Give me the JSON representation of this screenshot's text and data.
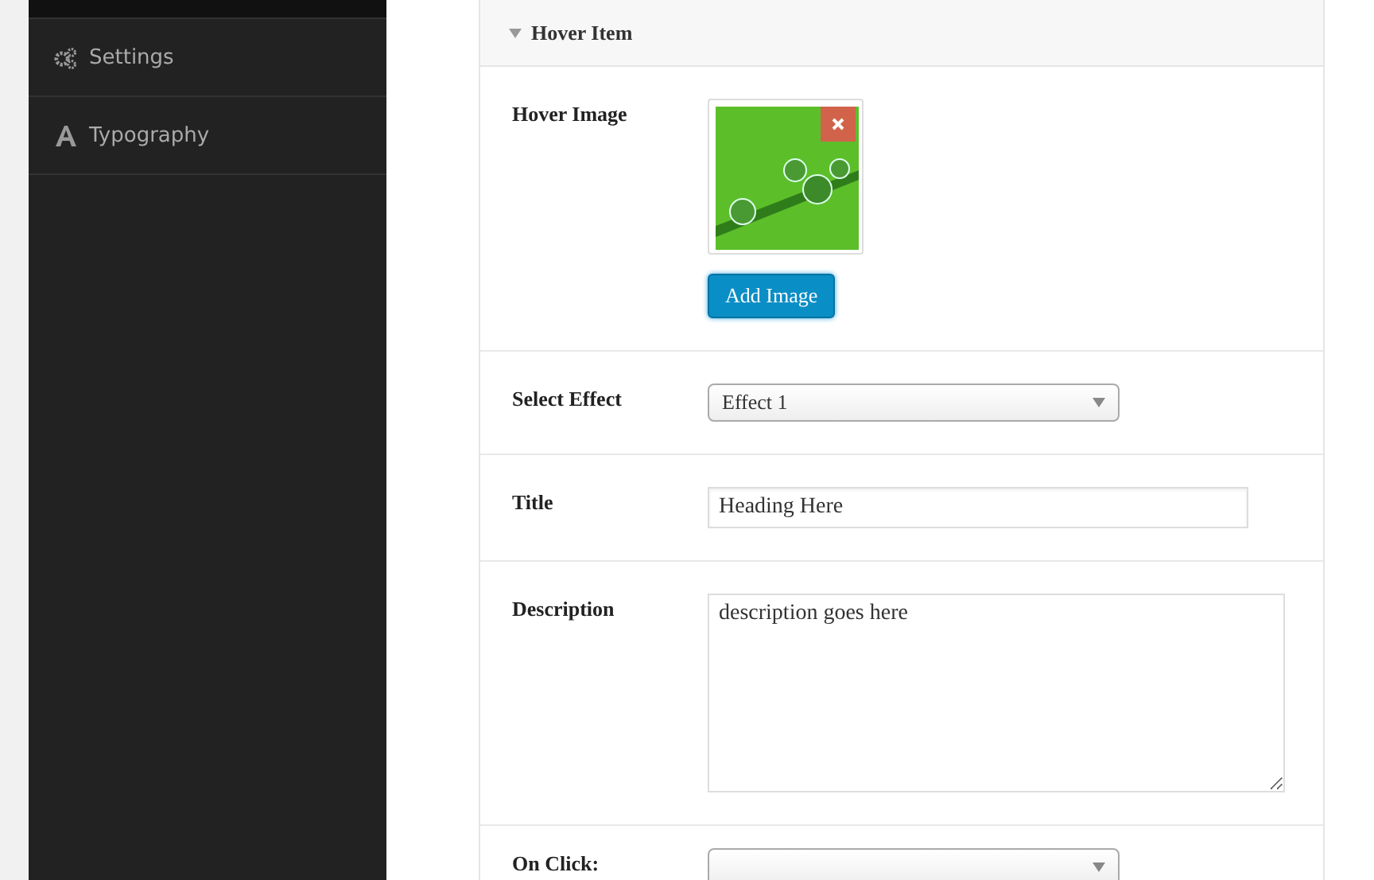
{
  "sidebar": {
    "items": [
      {
        "label": "Settings",
        "kind": "gears"
      },
      {
        "label": "Typography",
        "kind": "letter"
      }
    ]
  },
  "panel": {
    "title": "Hover Item",
    "expanded": true,
    "fields": [
      {
        "kind": "image",
        "label": "Hover Image",
        "button": "Add Image"
      },
      {
        "kind": "select",
        "label": "Select Effect",
        "value": "Effect 1"
      },
      {
        "kind": "text",
        "label": "Title",
        "value": "Heading Here"
      },
      {
        "kind": "textarea",
        "label": "Description",
        "value": "description goes here"
      },
      {
        "kind": "select",
        "label": "On Click:"
      }
    ]
  }
}
